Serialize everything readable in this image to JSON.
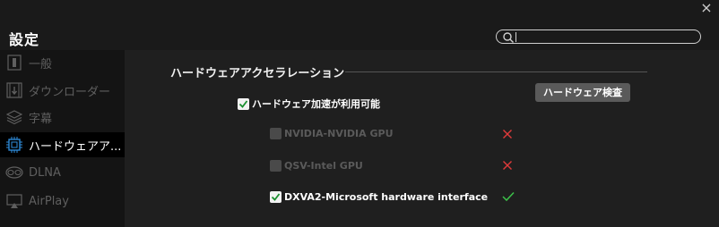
{
  "window": {
    "title": "設定",
    "close_glyph": "×"
  },
  "search": {
    "placeholder": "",
    "value": ""
  },
  "sidebar": {
    "items": [
      {
        "label": "一般",
        "icon": "general-icon",
        "active": false
      },
      {
        "label": "ダウンローダー",
        "icon": "film-download-icon",
        "active": false
      },
      {
        "label": "字幕",
        "icon": "layers-icon",
        "active": false
      },
      {
        "label": "ハードウェアア...",
        "icon": "chip-icon",
        "active": true
      },
      {
        "label": "DLNA",
        "icon": "dlna-icon",
        "active": false
      },
      {
        "label": "AirPlay",
        "icon": "airplay-icon",
        "active": false
      }
    ]
  },
  "main": {
    "section_title": "ハードウェアアクセラレーション",
    "hw_check_button": "ハードウェア検査",
    "hw_accel_enabled": {
      "label": "ハードウェア加速が利用可能",
      "checked": true
    },
    "decoders": [
      {
        "label": "NVIDIA-NVIDIA GPU",
        "checked": false,
        "enabled": false,
        "status": "unavailable"
      },
      {
        "label": "QSV-Intel GPU",
        "checked": false,
        "enabled": false,
        "status": "unavailable"
      },
      {
        "label": "DXVA2-Microsoft hardware interface",
        "checked": true,
        "enabled": true,
        "status": "available"
      }
    ]
  },
  "colors": {
    "active_icon": "#2f8fe0",
    "error": "#e03a3a",
    "ok": "#3cc24a"
  }
}
